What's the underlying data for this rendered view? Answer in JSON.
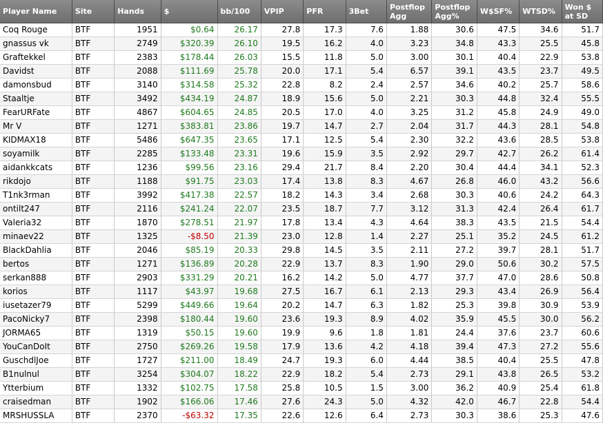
{
  "headers": [
    "Player Name",
    "Site",
    "Hands",
    "$",
    "bb/100",
    "VPIP",
    "PFR",
    "3Bet",
    "Postflop Agg",
    "Postflop Agg%",
    "W$SF%",
    "WTSD%",
    "Won $ at SD"
  ],
  "rows": [
    [
      "Coq Rouge",
      "BTF",
      "1951",
      "$0.64",
      "26.17",
      "27.8",
      "17.3",
      "7.6",
      "1.88",
      "30.6",
      "47.5",
      "34.6",
      "51.7"
    ],
    [
      "gnassus vk",
      "BTF",
      "2749",
      "$320.39",
      "26.10",
      "19.5",
      "16.2",
      "4.0",
      "3.23",
      "34.8",
      "43.3",
      "25.5",
      "45.8"
    ],
    [
      "Graftekkel",
      "BTF",
      "2383",
      "$178.44",
      "26.03",
      "15.5",
      "11.8",
      "5.0",
      "3.00",
      "30.1",
      "40.4",
      "22.9",
      "53.8"
    ],
    [
      "Davidst",
      "BTF",
      "2088",
      "$111.69",
      "25.78",
      "20.0",
      "17.1",
      "5.4",
      "6.57",
      "39.1",
      "43.5",
      "23.7",
      "49.5"
    ],
    [
      "damonsbud",
      "BTF",
      "3140",
      "$314.58",
      "25.32",
      "22.8",
      "8.2",
      "2.4",
      "2.57",
      "34.6",
      "40.2",
      "25.7",
      "58.6"
    ],
    [
      "Staaltje",
      "BTF",
      "3492",
      "$434.19",
      "24.87",
      "18.9",
      "15.6",
      "5.0",
      "2.21",
      "30.3",
      "44.8",
      "32.4",
      "55.5"
    ],
    [
      "FearURFate",
      "BTF",
      "4867",
      "$604.65",
      "24.85",
      "20.5",
      "17.0",
      "4.0",
      "3.25",
      "31.2",
      "45.8",
      "24.9",
      "49.0"
    ],
    [
      "Mr V",
      "BTF",
      "1271",
      "$383.81",
      "23.86",
      "19.7",
      "14.7",
      "2.7",
      "2.04",
      "31.7",
      "44.3",
      "28.1",
      "54.8"
    ],
    [
      "KIDMAX18",
      "BTF",
      "5486",
      "$647.35",
      "23.65",
      "17.1",
      "12.5",
      "5.4",
      "2.30",
      "32.2",
      "43.6",
      "28.5",
      "53.8"
    ],
    [
      "soyamilk",
      "BTF",
      "2285",
      "$133.48",
      "23.31",
      "19.6",
      "15.9",
      "3.5",
      "2.92",
      "29.7",
      "42.7",
      "26.2",
      "61.4"
    ],
    [
      "aidankkcats",
      "BTF",
      "1236",
      "$99.56",
      "23.16",
      "29.4",
      "21.7",
      "8.4",
      "2.20",
      "30.4",
      "44.4",
      "34.1",
      "52.3"
    ],
    [
      "rikdojo",
      "BTF",
      "1188",
      "$91.75",
      "23.03",
      "17.4",
      "13.8",
      "8.3",
      "4.67",
      "26.8",
      "46.0",
      "43.2",
      "56.6"
    ],
    [
      "T1nk3rman",
      "BTF",
      "3992",
      "$417.38",
      "22.57",
      "18.2",
      "14.3",
      "3.4",
      "2.68",
      "30.3",
      "40.6",
      "24.2",
      "64.3"
    ],
    [
      "ontilt247",
      "BTF",
      "2116",
      "$241.24",
      "22.07",
      "23.5",
      "18.7",
      "7.7",
      "3.12",
      "31.3",
      "42.4",
      "26.4",
      "61.7"
    ],
    [
      "Valeria32",
      "BTF",
      "1870",
      "$278.51",
      "21.97",
      "17.8",
      "13.4",
      "4.3",
      "4.64",
      "38.3",
      "43.5",
      "21.5",
      "54.4"
    ],
    [
      "minaev22",
      "BTF",
      "1325",
      "-$8.50",
      "21.39",
      "23.0",
      "12.8",
      "1.4",
      "2.27",
      "25.1",
      "35.2",
      "24.5",
      "61.2"
    ],
    [
      "BlackDahlia",
      "BTF",
      "2046",
      "$85.19",
      "20.33",
      "29.8",
      "14.5",
      "3.5",
      "2.11",
      "27.2",
      "39.7",
      "28.1",
      "51.7"
    ],
    [
      "bertos",
      "BTF",
      "1271",
      "$136.89",
      "20.28",
      "22.9",
      "13.7",
      "8.3",
      "1.90",
      "29.0",
      "50.6",
      "30.2",
      "57.5"
    ],
    [
      "serkan888",
      "BTF",
      "2903",
      "$331.29",
      "20.21",
      "16.2",
      "14.2",
      "5.0",
      "4.77",
      "37.7",
      "47.0",
      "28.6",
      "50.8"
    ],
    [
      "korios",
      "BTF",
      "1117",
      "$43.97",
      "19.68",
      "27.5",
      "16.7",
      "6.1",
      "2.13",
      "29.3",
      "43.4",
      "26.9",
      "56.4"
    ],
    [
      "iusetazer79",
      "BTF",
      "5299",
      "$449.66",
      "19.64",
      "20.2",
      "14.7",
      "6.3",
      "1.82",
      "25.3",
      "39.8",
      "30.9",
      "53.9"
    ],
    [
      "PacoNicky7",
      "BTF",
      "2398",
      "$180.44",
      "19.60",
      "23.6",
      "19.3",
      "8.9",
      "4.02",
      "35.9",
      "45.5",
      "30.0",
      "56.2"
    ],
    [
      "JORMA65",
      "BTF",
      "1319",
      "$50.15",
      "19.60",
      "19.9",
      "9.6",
      "1.8",
      "1.81",
      "24.4",
      "37.6",
      "23.7",
      "60.6"
    ],
    [
      "YouCanDoIt",
      "BTF",
      "2750",
      "$269.26",
      "19.58",
      "17.9",
      "13.6",
      "4.2",
      "4.18",
      "39.4",
      "47.3",
      "27.2",
      "55.6"
    ],
    [
      "GuschdlJoe",
      "BTF",
      "1727",
      "$211.00",
      "18.49",
      "24.7",
      "19.3",
      "6.0",
      "4.44",
      "38.5",
      "40.4",
      "25.5",
      "47.8"
    ],
    [
      "B1nulnul",
      "BTF",
      "3254",
      "$304.07",
      "18.22",
      "22.9",
      "18.2",
      "5.4",
      "2.73",
      "29.1",
      "43.8",
      "26.5",
      "53.2"
    ],
    [
      "Ytterbium",
      "BTF",
      "1332",
      "$102.75",
      "17.58",
      "25.8",
      "10.5",
      "1.5",
      "3.00",
      "36.2",
      "40.9",
      "25.4",
      "61.8"
    ],
    [
      "craisedman",
      "BTF",
      "1902",
      "$166.06",
      "17.46",
      "27.6",
      "24.3",
      "5.0",
      "4.32",
      "42.0",
      "46.7",
      "22.8",
      "54.4"
    ],
    [
      "MRSHUSSLA",
      "BTF",
      "2370",
      "-$63.32",
      "17.35",
      "22.6",
      "12.6",
      "6.4",
      "2.73",
      "30.3",
      "38.6",
      "25.3",
      "47.6"
    ]
  ],
  "colors": {
    "positive": "#1f7a1f",
    "negative": "#c00000",
    "header_bg": "#7d7d7d"
  }
}
